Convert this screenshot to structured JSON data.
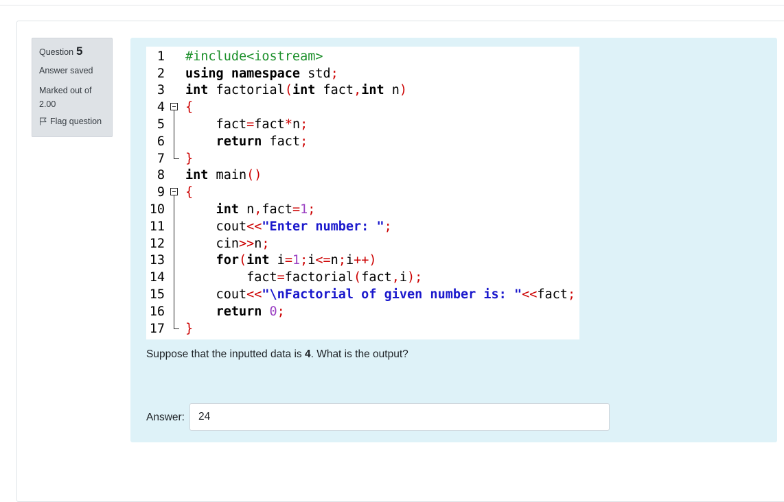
{
  "question_info": {
    "label": "Question",
    "number": "5",
    "state": "Answer saved",
    "marked_out_of": "Marked out of 2.00",
    "flag_label": "Flag question",
    "flag_icon": "flag-icon"
  },
  "code": {
    "line_numbers": [
      "1",
      "2",
      "3",
      "4",
      "5",
      "6",
      "7",
      "8",
      "9",
      "10",
      "11",
      "12",
      "13",
      "14",
      "15",
      "16",
      "17"
    ]
  },
  "question": {
    "text_before": "Suppose that the inputted data is ",
    "bold_value": "4",
    "text_after": ". What is the output?"
  },
  "answer": {
    "label": "Answer:",
    "value": "24"
  },
  "colors": {
    "content_bg": "#def2f8",
    "info_bg": "#dee2e6",
    "keyword": "#000000",
    "punct": "#cc0000",
    "string": "#1a18cc",
    "preprocessor": "#1b8f2a",
    "number": "#9a3fc2"
  }
}
